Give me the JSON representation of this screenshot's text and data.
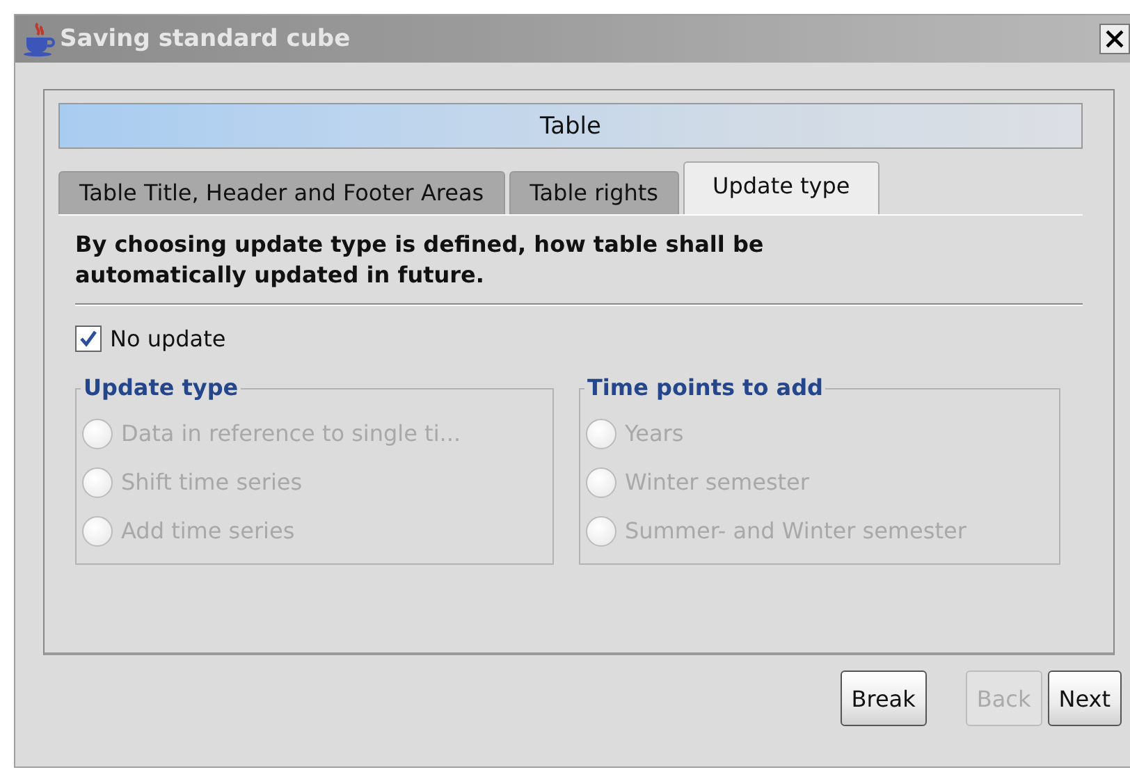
{
  "window": {
    "title": "Saving standard cube"
  },
  "header": "Table",
  "tabs": [
    {
      "label": "Table Title, Header and Footer Areas",
      "selected": false
    },
    {
      "label": "Table rights",
      "selected": false
    },
    {
      "label": "Update type",
      "selected": true
    }
  ],
  "description": "By choosing update type is defined, how table shall be automatically updated in future.",
  "no_update": {
    "label": "No update",
    "checked": true
  },
  "groups": [
    {
      "title": "Update type",
      "options": [
        {
          "label": "Data in reference to single ti...",
          "selected": false,
          "disabled": true
        },
        {
          "label": "Shift time series",
          "selected": false,
          "disabled": true
        },
        {
          "label": "Add time series",
          "selected": false,
          "disabled": true
        }
      ]
    },
    {
      "title": "Time points to add",
      "options": [
        {
          "label": "Years",
          "selected": false,
          "disabled": true
        },
        {
          "label": "Winter semester",
          "selected": false,
          "disabled": true
        },
        {
          "label": "Summer- and Winter semester",
          "selected": false,
          "disabled": true
        }
      ]
    }
  ],
  "buttons": [
    {
      "label": "Break",
      "disabled": false
    },
    {
      "label": "Back",
      "disabled": true
    },
    {
      "label": "Next",
      "disabled": false
    }
  ]
}
